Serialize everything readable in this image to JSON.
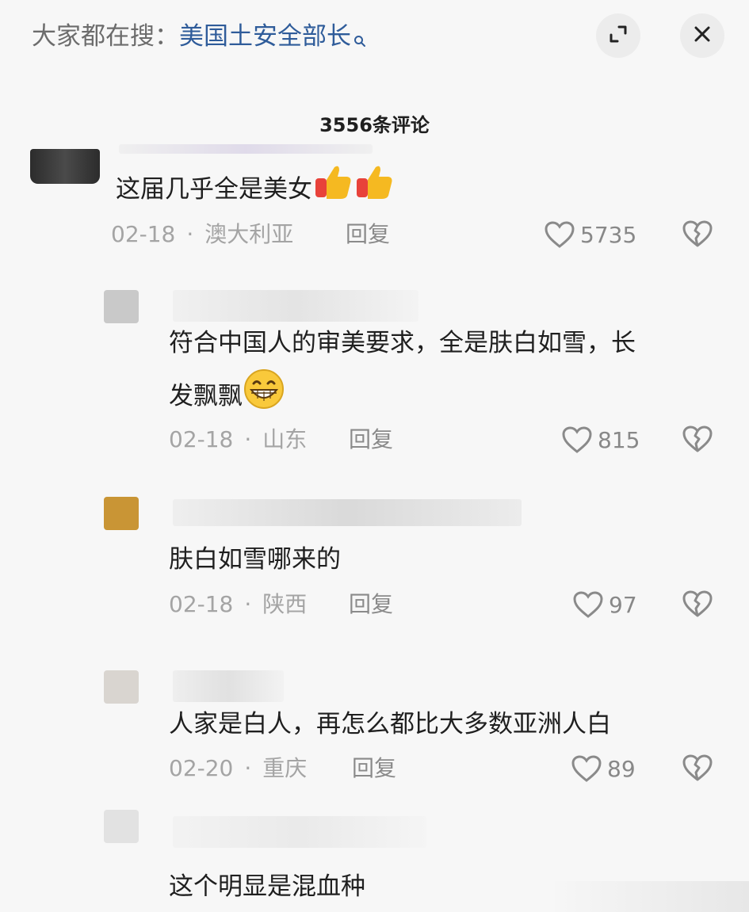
{
  "header": {
    "search_prefix": "大家都在搜：",
    "search_term": "美国土安全部长",
    "expand_icon": "expand-icon",
    "close_icon": "close-icon"
  },
  "comment_count": "3556条评论",
  "comments": [
    {
      "text": "这届几乎全是美女",
      "emoji": "thumbs-up x2",
      "date": "02-18",
      "location": "澳大利亚",
      "reply": "回复",
      "likes": "5735"
    },
    {
      "text_line1": "符合中国人的审美要求，全是肤白如雪，长",
      "text_line2": "发飘飘",
      "emoji": "grinning-face",
      "date": "02-18",
      "location": "山东",
      "reply": "回复",
      "likes": "815"
    },
    {
      "text": "肤白如雪哪来的",
      "date": "02-18",
      "location": "陕西",
      "reply": "回复",
      "likes": "97"
    },
    {
      "text": "人家是白人，再怎么都比大多数亚洲人白",
      "date": "02-20",
      "location": "重庆",
      "reply": "回复",
      "likes": "89"
    },
    {
      "text": "这个明显是混血种"
    }
  ],
  "colors": {
    "background": "#f7f7f7",
    "search_term": "#2f5c9a",
    "meta_gray": "#a4a4a4"
  }
}
